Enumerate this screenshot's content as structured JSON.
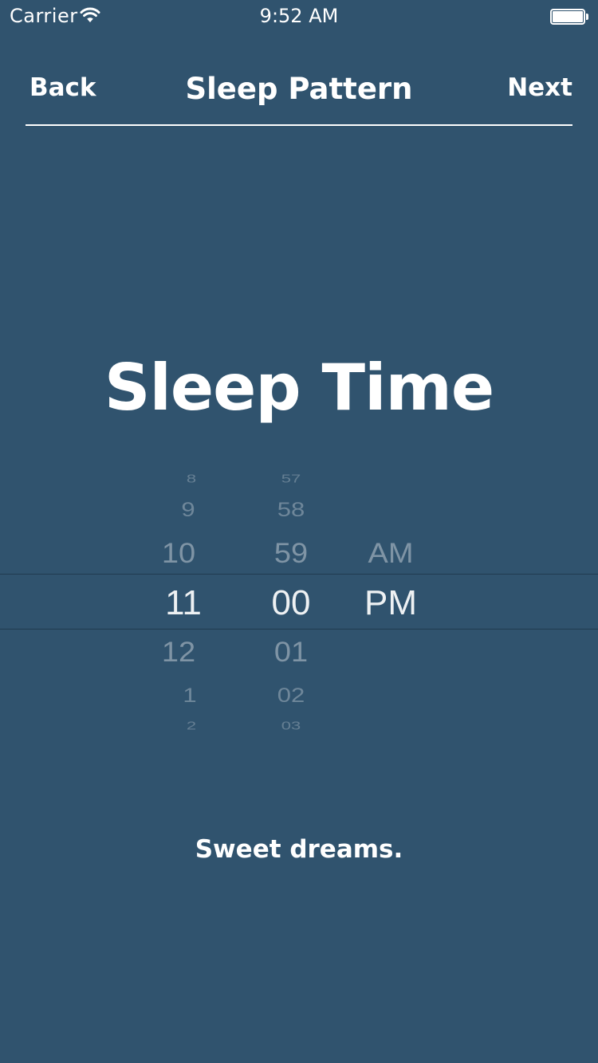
{
  "status_bar": {
    "carrier": "Carrier",
    "time": "9:52 AM"
  },
  "nav": {
    "back_label": "Back",
    "title": "Sleep Pattern",
    "next_label": "Next"
  },
  "heading": "Sleep Time",
  "picker": {
    "hour": {
      "above": [
        "8",
        "9",
        "10"
      ],
      "selected": "11",
      "below": [
        "12",
        "1",
        "2"
      ]
    },
    "minute": {
      "above": [
        "57",
        "58",
        "59"
      ],
      "selected": "00",
      "below": [
        "01",
        "02",
        "03"
      ]
    },
    "ampm": {
      "above": [
        "AM"
      ],
      "selected": "PM",
      "below": []
    }
  },
  "footer": "Sweet dreams.",
  "colors": {
    "background": "#30536E",
    "text": "#FFFFFF"
  }
}
